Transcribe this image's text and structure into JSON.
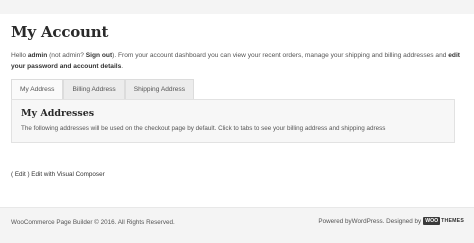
{
  "page": {
    "title": "My Account"
  },
  "intro": {
    "hello": "Hello ",
    "username": "admin",
    "not_user_prefix": " (not admin? ",
    "sign_out": "Sign out",
    "not_user_suffix": "). From your account dashboard you can view your recent orders, manage your shipping and billing addresses and ",
    "edit_link": "edit your password and account details",
    "end": "."
  },
  "tabs": [
    {
      "label": "My Address",
      "active": true
    },
    {
      "label": "Billing Address",
      "active": false
    },
    {
      "label": "Shipping Address",
      "active": false
    }
  ],
  "addresses": {
    "title": "My Addresses",
    "description": "The following addresses will be used on the checkout page by default. Click to tabs to see your billing address and shipping adress"
  },
  "edit": {
    "edit_label": "( Edit )",
    "composer_label": " Edit with Visual Composer"
  },
  "footer": {
    "copyright": "WooCommerce Page Builder © 2016. All Rights Reserved.",
    "powered_prefix": "Powered by ",
    "powered_link": "WordPress",
    "designed_prefix": ". Designed by ",
    "logo_woo": "WOO",
    "logo_themes": "THEMES"
  }
}
